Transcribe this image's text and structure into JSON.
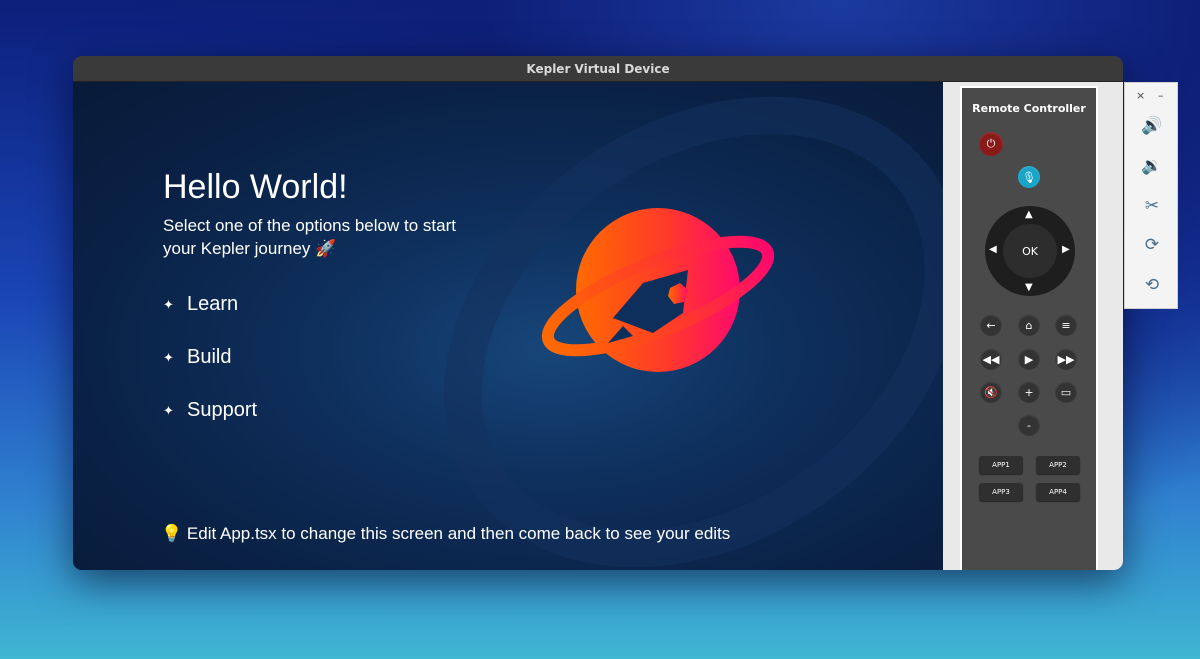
{
  "window": {
    "title": "Kepler Virtual Device"
  },
  "app": {
    "heading": "Hello World!",
    "subtitle": "Select one of the options below to start your Kepler journey 🚀",
    "menu": [
      {
        "label": "Learn",
        "icon": "sparkle-icon"
      },
      {
        "label": "Build",
        "icon": "sparkle-icon"
      },
      {
        "label": "Support",
        "icon": "sparkle-icon"
      }
    ],
    "hint_icon": "💡",
    "hint": "Edit App.tsx to change this screen and then come back to see your edits"
  },
  "remote": {
    "title": "Remote Controller",
    "ok_label": "OK",
    "plus_label": "+",
    "minus_label": "-",
    "apps": [
      "APP1",
      "APP2",
      "APP3",
      "APP4"
    ]
  },
  "side_panel": {
    "close": "×",
    "minimize": "–",
    "icons": [
      "volume-up-icon",
      "volume-down-icon",
      "scissors-icon",
      "rotate-icon",
      "rotate-reverse-icon"
    ]
  },
  "colors": {
    "logo_orange": "#ff6a00",
    "logo_pink": "#ff0a6c",
    "power_red": "#8a1a1a",
    "mic_teal": "#1aa5c8"
  }
}
